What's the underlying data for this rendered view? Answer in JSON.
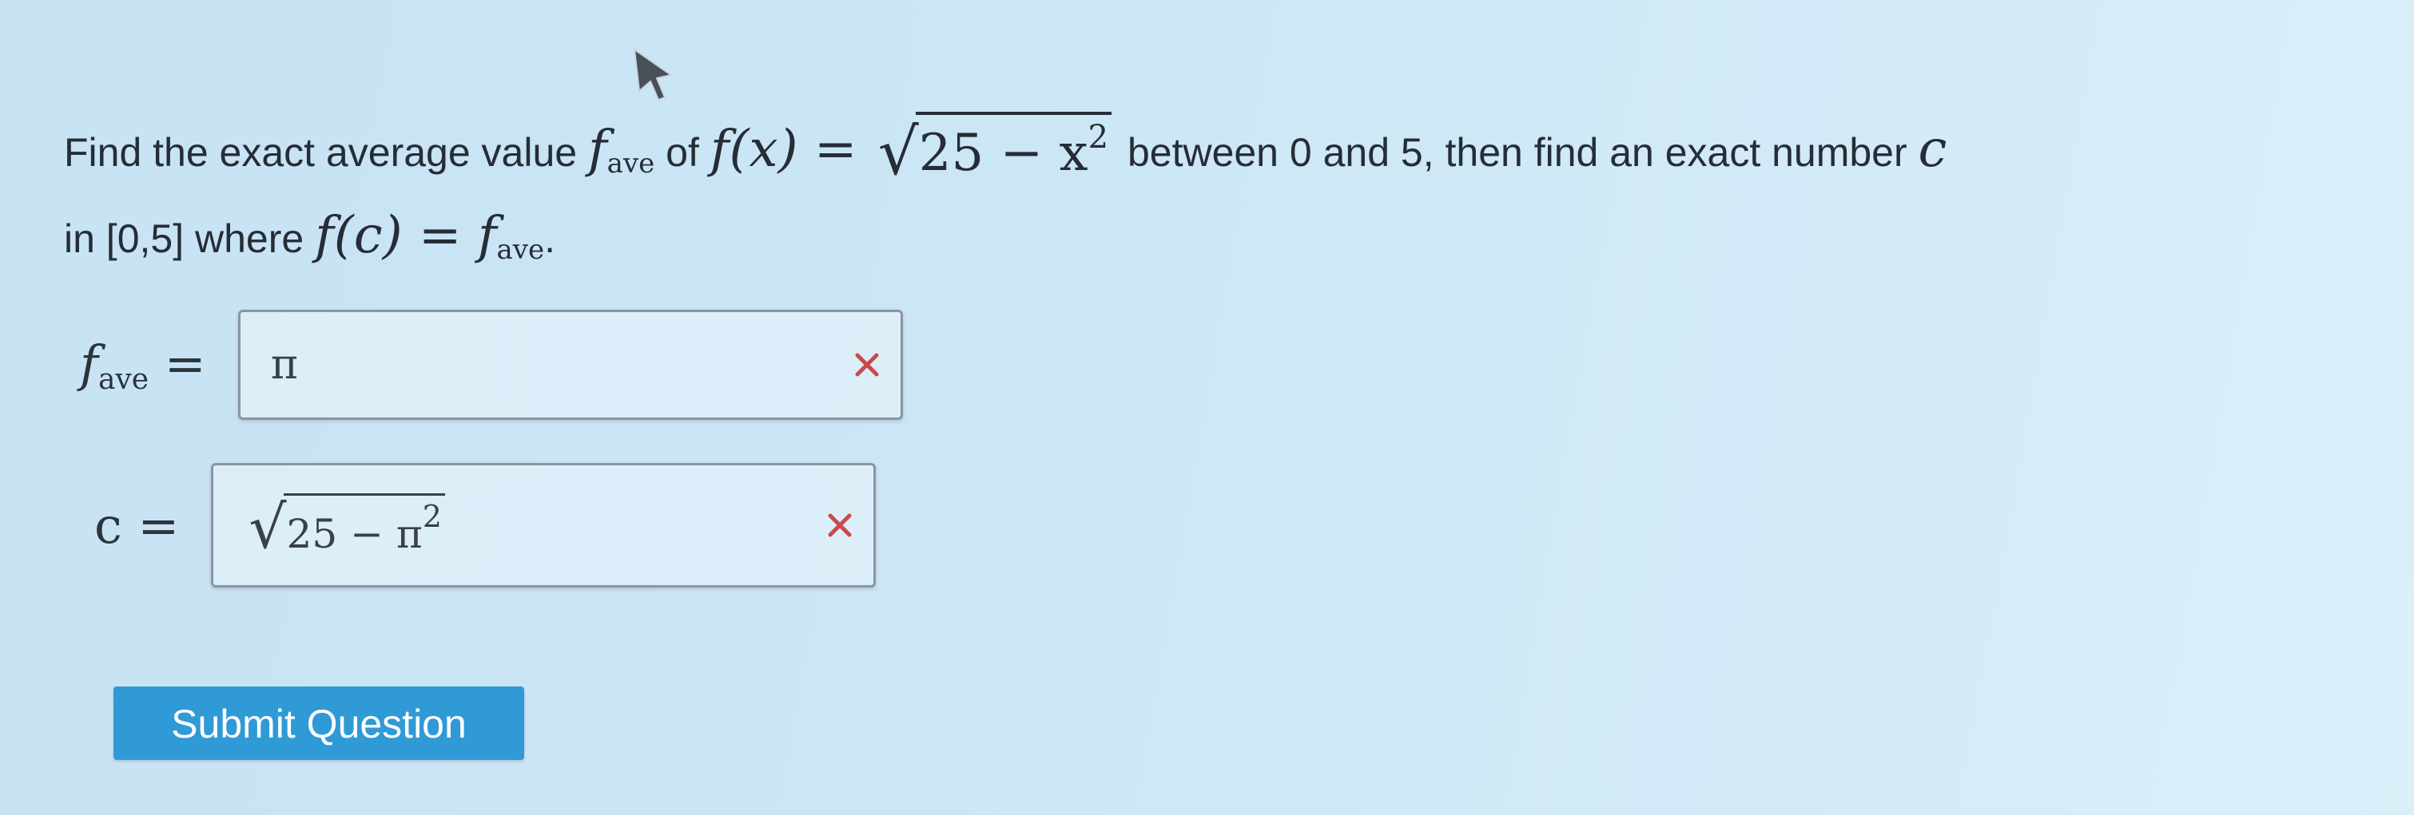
{
  "question": {
    "line1_prefix": "Find the exact average value ",
    "fave_symbol": "f",
    "fave_sub": "ave",
    "of_text": " of ",
    "func_lhs": "f(x) = ",
    "radicand_base": "25 − x",
    "radicand_exp": "2",
    "line1_suffix": " between 0 and 5, then find an exact number ",
    "var_c": "c",
    "line2_prefix": "in [0,5] where ",
    "fc_text": "f(c) = ",
    "line2_end": "."
  },
  "answers": {
    "fave": {
      "label_symbol": "f",
      "label_sub": "ave",
      "label_eq": " =",
      "value": "π"
    },
    "c": {
      "label": "c =",
      "value_base": "25 − π",
      "value_exp": "2"
    }
  },
  "submit_button": {
    "label": "Submit Question"
  },
  "colors": {
    "incorrect_mark": "#c94a4a",
    "button": "#2f9ad6"
  },
  "icons": {
    "incorrect": "x-mark-icon",
    "cursor": "mouse-pointer-icon"
  }
}
